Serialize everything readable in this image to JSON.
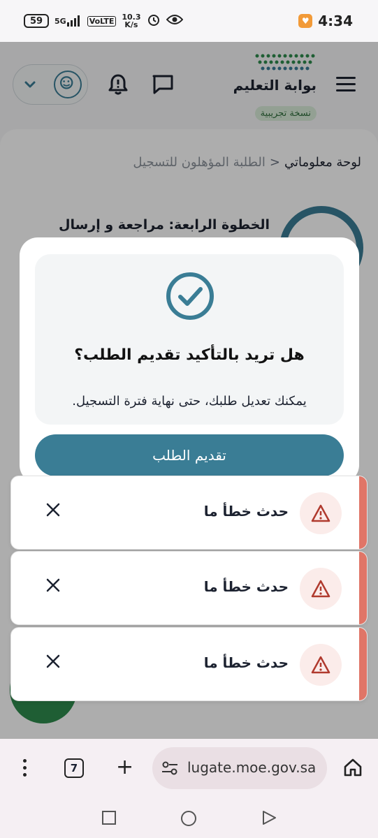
{
  "status_bar": {
    "battery": "59",
    "network": "5G",
    "volte": "VoLTE",
    "speed_value": "10.3",
    "speed_unit": "K/s",
    "time": "4:34"
  },
  "header": {
    "logo_title": "بوابة التعليم",
    "logo_badge": "نسخة تجريبية"
  },
  "breadcrumb": {
    "home": "لوحة معلوماتي",
    "separator": "<",
    "current": "الطلبة المؤهلون للتسجيل"
  },
  "step": {
    "title": "الخطوة الرابعة: مراجعة و إرسال"
  },
  "modal": {
    "title": "هل تريد بالتأكيد تقديم الطلب؟",
    "description": "يمكنك تعديل طلبك، حتى نهاية فترة التسجيل.",
    "submit_label": "تقديم الطلب"
  },
  "toasts": [
    {
      "message": "حدث خطأ ما"
    },
    {
      "message": "حدث خطأ ما"
    },
    {
      "message": "حدث خطأ ما"
    }
  ],
  "browser": {
    "tab_count": "7",
    "url": "lugate.moe.gov.sa"
  },
  "colors": {
    "primary": "#3a7d95",
    "error_bar": "#e07567",
    "warning_icon": "#b03a2e"
  },
  "icons": {
    "menu": "hamburger-icon",
    "chat": "chat-icon",
    "bell": "bell-alert-icon",
    "avatar": "user-avatar-icon",
    "chevron": "chevron-down-icon",
    "check": "check-circle-icon",
    "warning": "warning-triangle-icon",
    "close": "close-icon",
    "home": "home-icon"
  }
}
